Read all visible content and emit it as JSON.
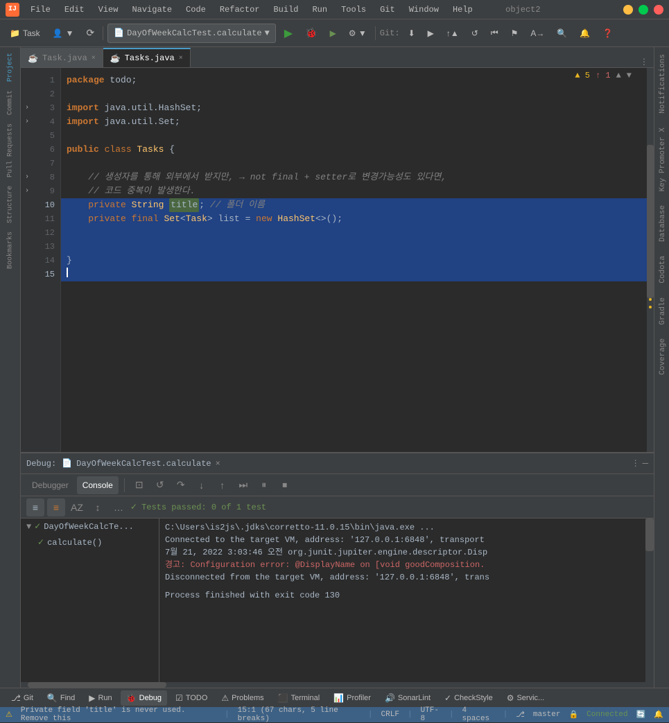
{
  "app": {
    "title": "object2",
    "icon": "IJ"
  },
  "menubar": {
    "items": [
      "File",
      "Edit",
      "View",
      "Navigate",
      "Code",
      "Refactor",
      "Build",
      "Run",
      "Tools",
      "Git",
      "Window",
      "Help"
    ]
  },
  "toolbar": {
    "task_label": "Task",
    "run_config": "DayOfWeekCalcTest.calculate",
    "git_label": "Git:"
  },
  "editor": {
    "tabs": [
      {
        "label": "Task.java",
        "active": false
      },
      {
        "label": "Tasks.java",
        "active": true
      }
    ],
    "warnings_count": "▲ 5",
    "errors_count": "↑ 1",
    "lines": [
      {
        "num": 1,
        "content": "package todo;",
        "type": "normal"
      },
      {
        "num": 2,
        "content": "",
        "type": "normal"
      },
      {
        "num": 3,
        "content": "import java.util.HashSet;",
        "type": "normal",
        "gutter": "fold"
      },
      {
        "num": 4,
        "content": "import java.util.Set;",
        "type": "normal",
        "gutter": "fold"
      },
      {
        "num": 5,
        "content": "",
        "type": "normal"
      },
      {
        "num": 6,
        "content": "public class Tasks {",
        "type": "normal"
      },
      {
        "num": 7,
        "content": "",
        "type": "normal"
      },
      {
        "num": 8,
        "content": "    // 생성자를 통해 외부에서 받지만, → not final + setter로 변경가능성도 있다면,",
        "type": "normal",
        "gutter": "fold"
      },
      {
        "num": 9,
        "content": "    // 코드 중복이 발생한다.",
        "type": "normal",
        "gutter": "fold"
      },
      {
        "num": 10,
        "content": "    private String title; // 폴더 이름",
        "type": "selected"
      },
      {
        "num": 11,
        "content": "    private final Set<Task> list = new HashSet<>();",
        "type": "selected"
      },
      {
        "num": 12,
        "content": "",
        "type": "selected"
      },
      {
        "num": 13,
        "content": "",
        "type": "selected"
      },
      {
        "num": 14,
        "content": "}",
        "type": "selected"
      },
      {
        "num": 15,
        "content": "",
        "type": "cursor"
      }
    ]
  },
  "debug": {
    "title": "Debug:",
    "tab_name": "DayOfWeekCalcTest.calculate",
    "sub_tabs": [
      "Debugger",
      "Console"
    ],
    "active_sub_tab": "Console",
    "toolbar_buttons": [
      "▼",
      "▲",
      "↑",
      "↓",
      "↔",
      "⏭",
      "⏸",
      "⏹"
    ],
    "tests_passed": "Tests passed: 0 of 1 test",
    "tree": {
      "items": [
        {
          "label": "DayOfWeekCalcTe...",
          "arrow": "▼",
          "status": "✓",
          "active": true
        },
        {
          "label": "calculate()",
          "status": "✓",
          "indent": true
        }
      ]
    },
    "console_lines": [
      "C:\\Users\\is2js\\.jdks\\corretto-11.0.15\\bin\\java.exe ...",
      "Connected to the target VM, address: '127.0.0.1:6848', transport",
      "7월 21, 2022 3:03:46 오전 org.junit.jupiter.engine.descriptor.Disp",
      "경고: Configuration error: @DisplayName on [void goodComposition.",
      "Disconnected from the target VM, address: '127.0.0.1:6848', trans",
      "",
      "Process finished with exit code 130"
    ]
  },
  "status_bar": {
    "warning_text": "Private field 'title' is never used. Remove this",
    "position": "15:1 (67 chars, 5 line breaks)",
    "encoding": "CRLF",
    "charset": "UTF-8",
    "indent": "4 spaces",
    "branch": "master",
    "connected": "Connected"
  },
  "bottom_tools": [
    {
      "label": "Git",
      "icon": "⎇"
    },
    {
      "label": "Find",
      "icon": "🔍"
    },
    {
      "label": "Run",
      "icon": "▶"
    },
    {
      "label": "Debug",
      "icon": "🐛",
      "active": true
    },
    {
      "label": "TODO",
      "icon": "☑"
    },
    {
      "label": "Problems",
      "icon": "⚠"
    },
    {
      "label": "Terminal",
      "icon": "⬛"
    },
    {
      "label": "Profiler",
      "icon": "📊"
    },
    {
      "label": "SonarLint",
      "icon": "🔊"
    },
    {
      "label": "CheckStyle",
      "icon": "✓"
    },
    {
      "label": "Servic...",
      "icon": "⚙"
    }
  ],
  "right_tabs": [
    "Notifications",
    "Key Promoter X",
    "Database",
    "Codota",
    "Gradle",
    "Coverage"
  ],
  "icons": {
    "fold": "›",
    "arrow_down": "▼",
    "arrow_up": "▲",
    "check": "✓",
    "warning": "⚠",
    "gear": "⚙",
    "bug": "🐞",
    "play": "▶",
    "stop": "⏹",
    "step_over": "↷",
    "step_into": "↓",
    "step_out": "↑",
    "resume": "▶",
    "close": "×"
  }
}
